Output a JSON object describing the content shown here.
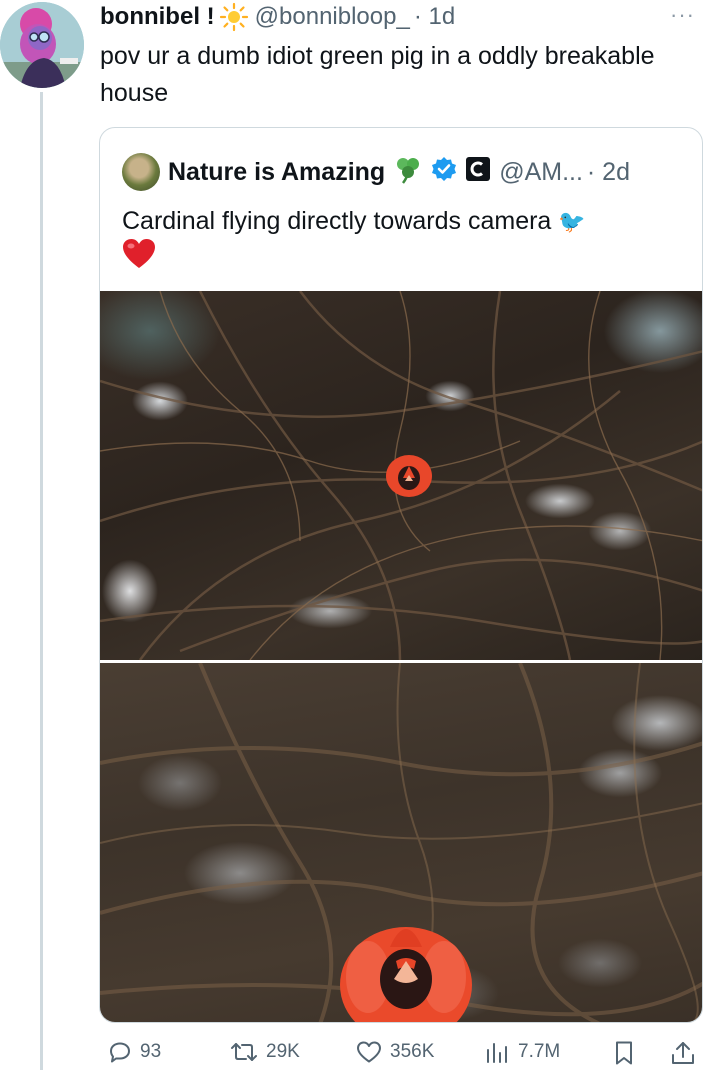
{
  "tweet": {
    "display_name": "bonnibel !",
    "handle": "@bonnibloop_",
    "time": "· 1d",
    "more_label": "···",
    "text": "pov ur a dumb idiot green pig in a oddly breakable house"
  },
  "quote": {
    "display_name": "Nature is Amazing",
    "handle": "@AM...",
    "time": "· 2d",
    "text": "Cardinal flying directly towards camera",
    "emoji_bird": "🐦",
    "emoji_heart": "❤️"
  },
  "actions": {
    "replies": "93",
    "reposts": "29K",
    "likes": "356K",
    "views": "7.7M"
  },
  "colors": {
    "text": "#0f1419",
    "muted": "#536471",
    "border": "#cfd9de",
    "verified": "#1d9bf0",
    "cardinal": "#e8472a"
  },
  "icons": [
    "sun-emoji-icon",
    "shamrock-icon",
    "verified-badge-icon",
    "affiliate-badge-icon",
    "reply-icon",
    "repost-icon",
    "like-icon",
    "views-icon",
    "bookmark-icon",
    "share-icon"
  ]
}
